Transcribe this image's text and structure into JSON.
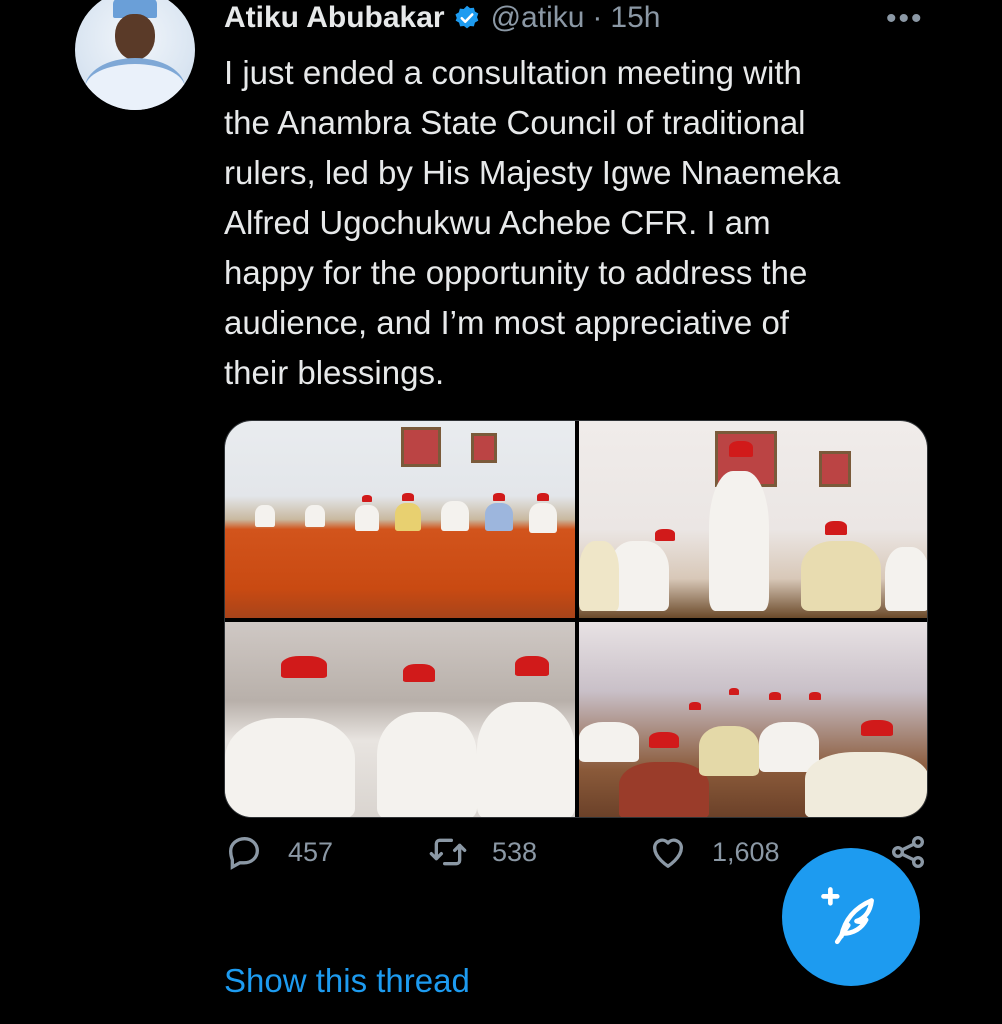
{
  "tweet": {
    "author_name": "Atiku Abubakar",
    "handle": "@atiku",
    "separator": "·",
    "time": "15h",
    "more_label": "•••",
    "text": "I just ended a consultation meeting with\nthe Anambra State Council of traditional\nrulers, led by His Majesty Igwe Nnaemeka\nAlfred Ugochukwu Achebe CFR. I am\nhappy for the opportunity to address the\naudience, and I’m most appreciative of\ntheir blessings.",
    "media_count": 4,
    "stats": {
      "replies": "457",
      "retweets": "538",
      "likes": "1,608"
    },
    "show_thread_label": "Show this thread"
  },
  "icons": {
    "verified": "verified-badge-icon",
    "reply": "reply-icon",
    "retweet": "retweet-icon",
    "like": "heart-icon",
    "share": "share-icon",
    "compose": "compose-tweet-icon"
  },
  "colors": {
    "accent": "#1d9bf0",
    "background": "#000000",
    "text": "#e7e9ea",
    "secondary_text": "#8b98a5"
  }
}
